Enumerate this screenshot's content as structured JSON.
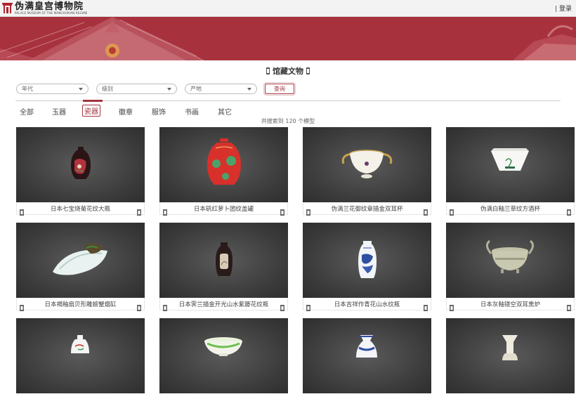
{
  "header": {
    "logo_cn": "伪满皇宫博物院",
    "logo_en": "PALACE MUSEUM OF THE MANCHURIAN REGIME",
    "auth_label": "| 登录"
  },
  "section_title": "馆藏文物",
  "filters": [
    {
      "placeholder": "年代"
    },
    {
      "placeholder": "级别"
    },
    {
      "placeholder": "产地"
    }
  ],
  "query_label": "查询",
  "tabs": [
    {
      "label": "全部"
    },
    {
      "label": "玉器"
    },
    {
      "label": "瓷器",
      "active": true
    },
    {
      "label": "徽章"
    },
    {
      "label": "服饰"
    },
    {
      "label": "书画"
    },
    {
      "label": "其它"
    }
  ],
  "result_count": "共搜索到 120 个模型",
  "items": [
    {
      "title": "日本七宝烧菊花纹大瓶",
      "icon": "red-black-vase-icon"
    },
    {
      "title": "日本矾红萝卜团纹盖罐",
      "icon": "red-lidded-jar-icon"
    },
    {
      "title": "伪满兰花御纹章描金双耳杯",
      "icon": "two-handled-cup-icon"
    },
    {
      "title": "伪满白釉兰草纹方酒杯",
      "icon": "square-cup-icon"
    },
    {
      "title": "日本褐釉扇贝形雕螃蟹烟缸",
      "icon": "shell-ashtray-icon"
    },
    {
      "title": "日本霁兰描金开光山水紫藤花纹瓶",
      "icon": "dark-vase-icon"
    },
    {
      "title": "日本吉祥作青花山水纹瓶",
      "icon": "blue-white-vase-icon"
    },
    {
      "title": "日本灰釉镂空双耳熏炉",
      "icon": "censer-icon"
    },
    {
      "title": "",
      "icon": "small-white-vase-icon"
    },
    {
      "title": "",
      "icon": "green-bowl-icon"
    },
    {
      "title": "",
      "icon": "blue-vase-icon"
    },
    {
      "title": "",
      "icon": "white-vase-icon"
    }
  ],
  "colors": {
    "accent": "#a4343f",
    "banner": "#a7323e"
  }
}
